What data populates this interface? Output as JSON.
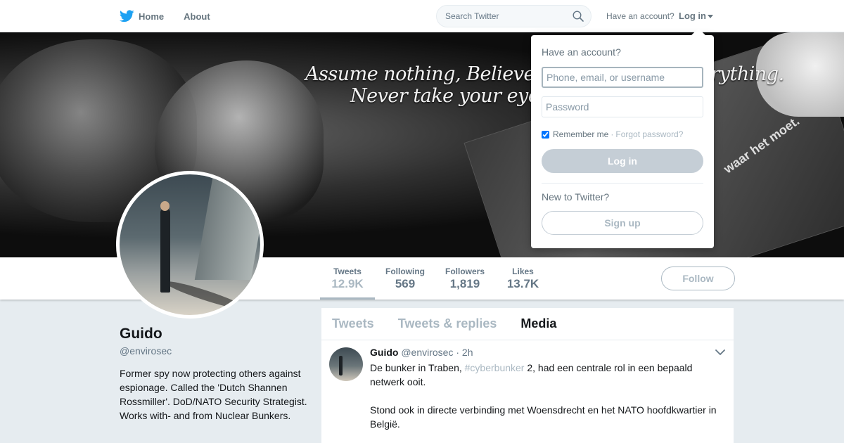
{
  "nav": {
    "home_label": "Home",
    "about_label": "About",
    "search_placeholder": "Search Twitter",
    "have_account": "Have an account?",
    "login_label": "Log in"
  },
  "banner": {
    "slogan_line1": "Assume nothing, Believe no-one, Check everything.",
    "slogan_line2": "Never take your eye off the ball",
    "card_text": "waar het moet."
  },
  "stats": [
    {
      "label": "Tweets",
      "value": "12.9K",
      "active": true
    },
    {
      "label": "Following",
      "value": "569"
    },
    {
      "label": "Followers",
      "value": "1,819"
    },
    {
      "label": "Likes",
      "value": "13.7K"
    }
  ],
  "follow_label": "Follow",
  "profile": {
    "name": "Guido",
    "handle": "@envirosec",
    "bio": "Former spy now protecting others against espionage. Called the 'Dutch Shannen Rossmiller'. DoD/NATO Security Strategist. Works with- and from Nuclear Bunkers."
  },
  "timeline": {
    "tabs": [
      "Tweets",
      "Tweets & replies",
      "Media"
    ],
    "active_tab": "Media",
    "tweet": {
      "name": "Guido",
      "handle": "@envirosec",
      "time": "· 2h",
      "text_before": "De bunker in Traben, ",
      "hashtag": "#cyberbunker",
      "text_after": " 2, had een centrale rol in een bepaald netwerk ooit.",
      "paragraph2": "Stond ook in directe verbinding met Woensdrecht en het NATO hoofdkwartier in België."
    }
  },
  "login_dropdown": {
    "title": "Have an account?",
    "username_placeholder": "Phone, email, or username",
    "password_placeholder": "Password",
    "remember_label": "Remember me",
    "separator": "·",
    "forgot_label": "Forgot password?",
    "login_button": "Log in",
    "new_label": "New to Twitter?",
    "signup_button": "Sign up"
  },
  "colors": {
    "accent_muted": "#aab8c2",
    "twitter_blue": "#1da1f2"
  }
}
